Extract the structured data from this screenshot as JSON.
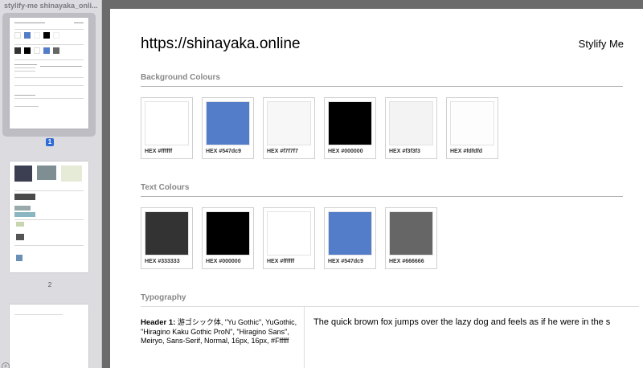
{
  "sidebar": {
    "title": "stylify-me shinayaka_onli...",
    "pages": [
      {
        "number": "1",
        "selected": true
      },
      {
        "number": "2",
        "selected": false
      }
    ],
    "add_icon": "+"
  },
  "page": {
    "url": "https://shinayaka.online",
    "brand": "Stylify Me",
    "background_section": {
      "title": "Background Colours",
      "swatches": [
        {
          "label": "HEX #ffffff",
          "color": "#ffffff"
        },
        {
          "label": "HEX #547dc9",
          "color": "#547dc9"
        },
        {
          "label": "HEX #f7f7f7",
          "color": "#f7f7f7"
        },
        {
          "label": "HEX #000000",
          "color": "#000000"
        },
        {
          "label": "HEX #f3f3f3",
          "color": "#f3f3f3"
        },
        {
          "label": "HEX #fdfdfd",
          "color": "#fdfdfd"
        }
      ]
    },
    "text_section": {
      "title": "Text Colours",
      "swatches": [
        {
          "label": "HEX #333333",
          "color": "#333333"
        },
        {
          "label": "HEX #000000",
          "color": "#000000"
        },
        {
          "label": "HEX #ffffff",
          "color": "#ffffff"
        },
        {
          "label": "HEX #547dc9",
          "color": "#547dc9"
        },
        {
          "label": "HEX #666666",
          "color": "#666666"
        }
      ]
    },
    "typography_section": {
      "title": "Typography",
      "header1_label": "Header 1:",
      "header1_spec": "游ゴシック体, \"Yu Gothic\", YuGothic, \"Hiragino Kaku Gothic ProN\", \"Hiragino Sans\", Meiryo, Sans-Serif, Normal, 16px, 16px, #Ffffff",
      "sample_text": "The quick brown fox jumps over the lazy dog and feels as if he were in the s"
    }
  }
}
